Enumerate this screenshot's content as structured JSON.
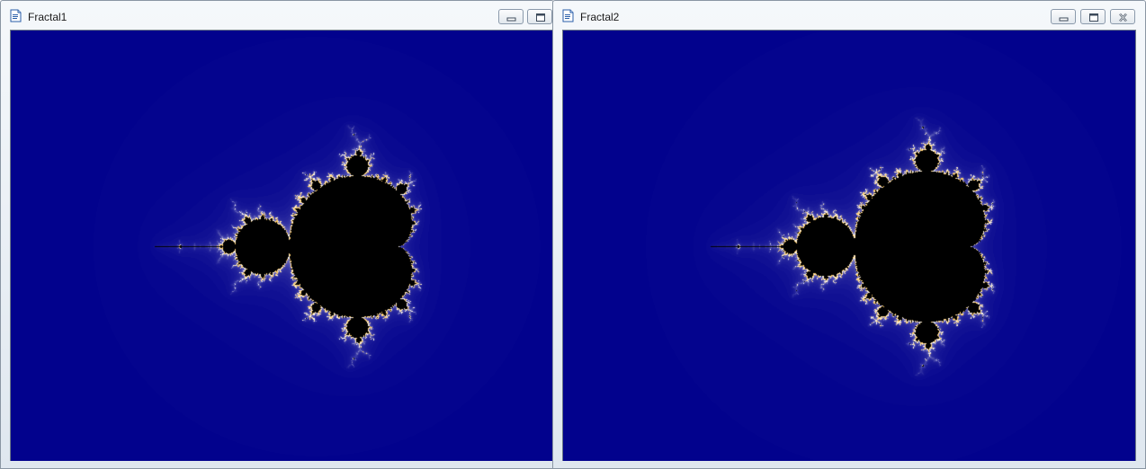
{
  "windows": [
    {
      "title": "Fractal1",
      "icons": {
        "doc": "document-icon",
        "minimize": "minimize-icon",
        "restore": "restore-icon"
      }
    },
    {
      "title": "Fractal2",
      "icons": {
        "doc": "document-icon",
        "minimize": "minimize-icon",
        "restore": "restore-icon",
        "close": "close-icon"
      }
    }
  ],
  "fractal": {
    "type": "Mandelbrot set",
    "colors": {
      "background": "#00008c",
      "interior": "#000000",
      "edge_glow": "#ffffff",
      "edge_warm": "#ffcc66"
    }
  }
}
